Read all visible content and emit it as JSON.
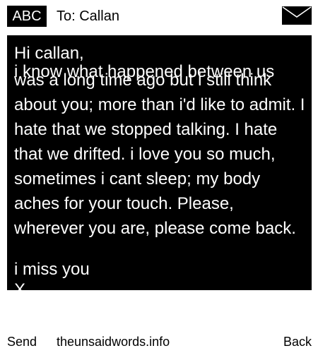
{
  "header": {
    "input_mode": "ABC",
    "recipient": "To: Callan",
    "envelope_icon": "envelope-icon"
  },
  "message": {
    "greeting": "Hi callan,",
    "overlap_line": "i know what happened between us",
    "body": "was a long time ago but i still think about you; more than i'd like to admit. I hate that we stopped talking. I hate that we drifted. i love you so much, sometimes i cant sleep; my body aches for your touch. Please, wherever you are, please come back.",
    "closing": "i miss you",
    "signoff": "X"
  },
  "footer": {
    "send_label": "Send",
    "site_label": "theunsaidwords.info",
    "back_label": "Back"
  },
  "colors": {
    "background": "#ffffff",
    "message_background": "#000000",
    "message_text": "#ffffff",
    "text": "#000000"
  }
}
